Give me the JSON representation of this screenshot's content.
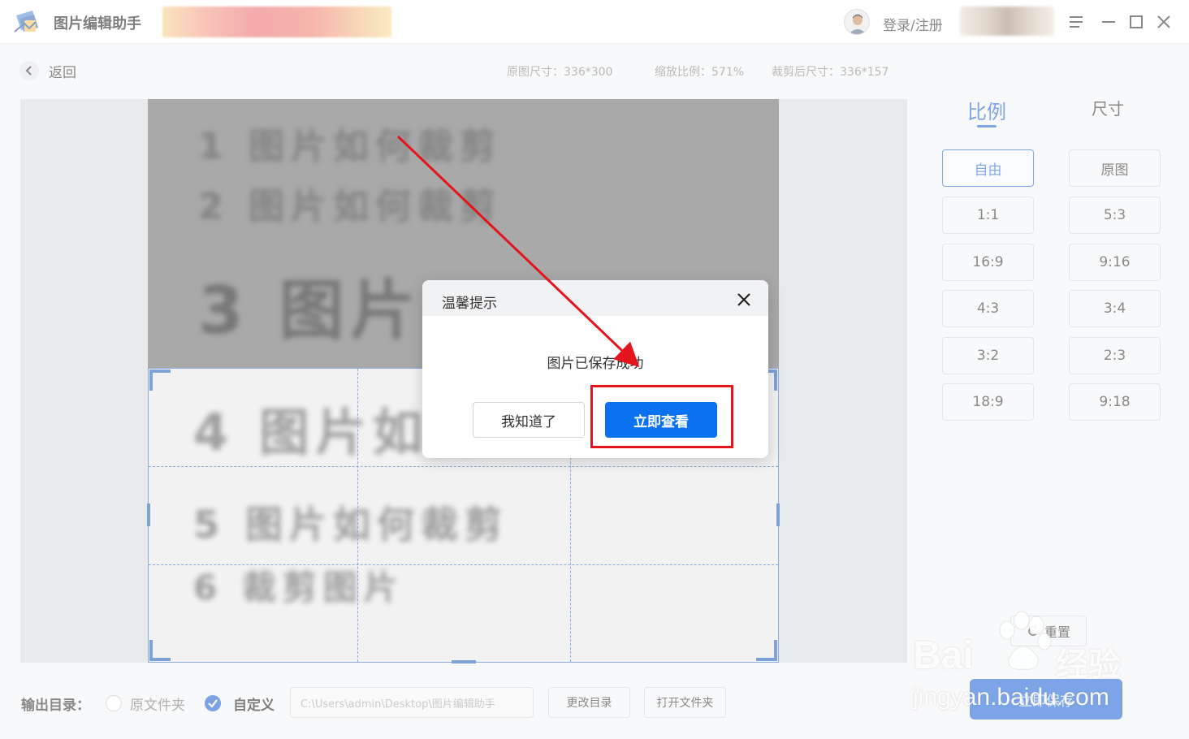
{
  "app": {
    "title": "图片编辑助手",
    "login_label": "登录/注册"
  },
  "toolbar": {
    "back_label": "返回",
    "original_size": "原图尺寸：336*300",
    "zoom_ratio": "缩放比例：571%",
    "cropped_size": "裁剪后尺寸：336*157"
  },
  "image": {
    "lines": [
      {
        "num": "1",
        "text": "图片如何裁剪"
      },
      {
        "num": "2",
        "text": "图片如何裁剪"
      },
      {
        "num": "3",
        "text": "图片"
      },
      {
        "num": "4",
        "text": "图片如何"
      },
      {
        "num": "5",
        "text": "图片如何裁剪"
      },
      {
        "num": "6",
        "text": "裁剪图片"
      }
    ]
  },
  "panel": {
    "tabs": [
      {
        "label": "比例",
        "active": true
      },
      {
        "label": "尺寸",
        "active": false
      }
    ],
    "ratios": [
      "自由",
      "原图",
      "1:1",
      "5:3",
      "16:9",
      "9:16",
      "4:3",
      "3:4",
      "3:2",
      "2:3",
      "18:9",
      "9:18"
    ],
    "active_ratio": "自由",
    "reset_label": "重置",
    "save_label": "立即保存"
  },
  "output": {
    "label": "输出目录：",
    "options": [
      {
        "label": "原文件夹",
        "checked": false
      },
      {
        "label": "自定义",
        "checked": true
      }
    ],
    "path": "C:\\Users\\admin\\Desktop\\图片编辑助手",
    "change_dir_label": "更改目录",
    "open_folder_label": "打开文件夹"
  },
  "dialog": {
    "title": "温馨提示",
    "message": "图片已保存成功",
    "dismiss_label": "我知道了",
    "view_label": "立即查看"
  },
  "watermark": {
    "brand_left": "Bai",
    "brand_right": "经验",
    "url": "jingyan.baidu.com"
  },
  "colors": {
    "accent": "#1f66d4",
    "primary_button": "#0a72f0",
    "highlight": "#e3141b"
  }
}
